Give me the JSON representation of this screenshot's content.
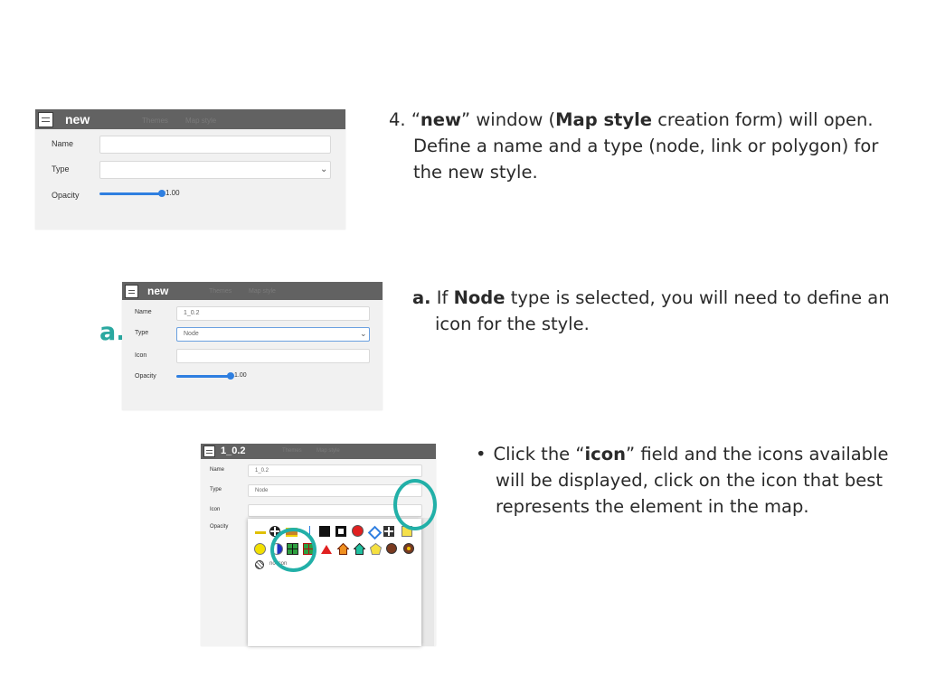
{
  "step4": {
    "number": "4.",
    "quote_open": "“",
    "new_word": "new",
    "t1": "” window (",
    "map_style": "Map style",
    "t2": " creation form) will open.",
    "line2": "Define a name and a type (node, link or polygon) for",
    "line3": "the new style."
  },
  "stepA": {
    "label": "a.",
    "t1": " If ",
    "node_word": "Node",
    "t2": " type is selected, you will need to define an",
    "line2": "icon for the style.",
    "marker": "a."
  },
  "bullet": {
    "dot": "•",
    "t1": "Click the “",
    "icon_word": "icon",
    "t2": "” field and the icons available",
    "line2": "will be displayed, click on the icon that best",
    "line3": "represents the element in the map."
  },
  "window1": {
    "title": "new",
    "ghost_tabs": [
      "Themes",
      "Map style"
    ],
    "name_label": "Name",
    "name_value": "",
    "type_label": "Type",
    "type_value": "",
    "opacity_label": "Opacity",
    "opacity_value": "1.00",
    "opacity_fraction": 1.0
  },
  "window2": {
    "title": "new",
    "ghost_tabs": [
      "Themes",
      "Map style"
    ],
    "name_label": "Name",
    "name_value": "1_0.2",
    "type_label": "Type",
    "type_value": "Node",
    "icon_label": "Icon",
    "icon_value": "",
    "opacity_label": "Opacity",
    "opacity_value": "1.00",
    "opacity_fraction": 1.0
  },
  "window3": {
    "title": "1_0.2",
    "ghost_tabs": [
      "Themes",
      "Map style"
    ],
    "name_label": "Name",
    "name_value": "1_0.2",
    "type_label": "Type",
    "type_value": "Node",
    "icon_label": "Icon",
    "icon_value": "",
    "opacity_label": "Opacity",
    "no_icon_label": "no icon"
  },
  "colors": {
    "accent_teal": "#22b0a8",
    "titlebar": "#626262",
    "slider_blue": "#2f7fe0",
    "form_bg": "#f1f1f1"
  }
}
